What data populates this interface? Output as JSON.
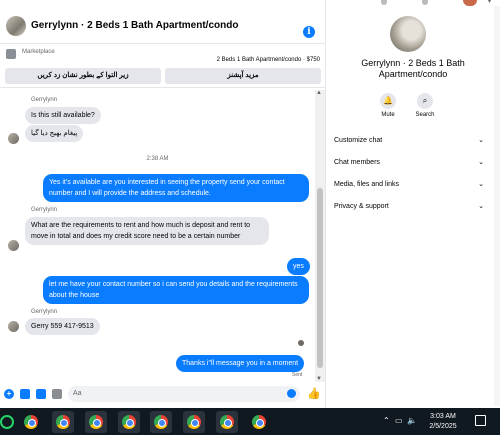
{
  "chat": {
    "title": "Gerrylynn · 2 Beds 1 Bath Apartment/condo",
    "marketplace_label": "Marketplace",
    "listing": "2 Beds 1 Bath Apartment/condo · $750",
    "btn_mark_pending": "زیر التوا کے بطور نشان زد کریں",
    "btn_more_options": "مزید آپشنز",
    "composer_placeholder": "Aa"
  },
  "messages": {
    "sender1": "Gerrylynn",
    "m1": "Is this still available?",
    "m2": "پیغام بھیج دیا گیا",
    "time": "2:38 AM",
    "m3": "Yes it's available are you interested in seeing the property send your contact number and I will provide the address and schedule.",
    "sender2": "Gerrylynn",
    "m4": "What are the requirements to rent and how much is deposit and rent to move in total and does my credit score need to be a certain number",
    "m5": "yes",
    "m6": "let me have your contact number so i can send you details and the requirements about the house",
    "sender3": "Gerrylynn",
    "m7": "Gerry 559 417-9513",
    "m8": "Thanks i\"ll message you in a moment",
    "status": "Sent"
  },
  "detail": {
    "name": "Gerrylynn · 2 Beds 1 Bath Apartment/condo",
    "mute": "Mute",
    "search": "Search",
    "rows": [
      "Customize chat",
      "Chat members",
      "Media, files and links",
      "Privacy & support"
    ]
  },
  "taskbar": {
    "time": "3:03 AM",
    "date": "2/5/2025"
  },
  "colors": {
    "accent": "#0a7cff",
    "bubble_in": "#e4e6eb",
    "taskbar": "#101820"
  }
}
